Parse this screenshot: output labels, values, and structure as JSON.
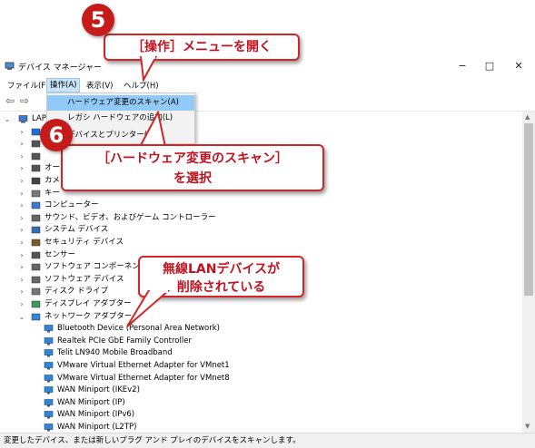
{
  "window": {
    "title": "デバイス マネージャー",
    "minimize": "−",
    "maximize": "□",
    "close": "✕"
  },
  "menu": {
    "items": [
      "ファイル(F)",
      "操作(A)",
      "表示(V)",
      "ヘルプ(H)"
    ]
  },
  "dropdown": {
    "items": [
      "ハードウェア変更のスキャン(A)",
      "レガシ ハードウェアの追加(L)",
      "デバイスとプリンター(V)"
    ]
  },
  "tree": {
    "root": "LAP",
    "categories": [
      {
        "label": "",
        "icon": "bluetooth-icon"
      },
      {
        "label": "",
        "icon": "device-icon"
      },
      {
        "label": "",
        "icon": "device-icon"
      },
      {
        "label": "オー",
        "icon": "audio-icon"
      },
      {
        "label": "カメ",
        "icon": "camera-icon"
      },
      {
        "label": "キー",
        "icon": "keyboard-icon"
      },
      {
        "label": "コンピューター",
        "icon": "computer-icon"
      },
      {
        "label": "サウンド、ビデオ、およびゲーム コントローラー",
        "icon": "speaker-icon"
      },
      {
        "label": "システム デバイス",
        "icon": "system-icon"
      },
      {
        "label": "セキュリティ デバイス",
        "icon": "security-icon"
      },
      {
        "label": "センサー",
        "icon": "sensor-icon"
      },
      {
        "label": "ソフトウェア コンポーネント",
        "icon": "software-icon"
      },
      {
        "label": "ソフトウェア デバイス",
        "icon": "software-icon"
      },
      {
        "label": "ディスク ドライブ",
        "icon": "disk-icon"
      },
      {
        "label": "ディスプレイ アダプター",
        "icon": "display-icon"
      },
      {
        "label": "ネットワーク アダプター",
        "icon": "network-icon"
      }
    ],
    "network_children": [
      "Bluetooth Device (Personal Area Network)",
      "Realtek PCIe GbE Family Controller",
      "Telit LN940 Mobile Broadband",
      "VMware Virtual Ethernet Adapter for VMnet1",
      "VMware Virtual Ethernet Adapter for VMnet8",
      "WAN Miniport (IKEv2)",
      "WAN Miniport (IP)",
      "WAN Miniport (IPv6)",
      "WAN Miniport (L2TP)"
    ]
  },
  "status": "変更したデバイス、または新しいプラグ アンド プレイのデバイスをスキャンします。",
  "annotations": {
    "step5_number": "5",
    "step5_text": "［操作］メニューを開く",
    "step6_number": "6",
    "step6_line1": "［ハードウェア変更のスキャン］",
    "step6_line2": "を選択",
    "note_line1": "無線LANデバイスが",
    "note_line2": "削除されている"
  },
  "colors": {
    "accent_red": "#c61b1b",
    "menu_highlight": "#91c9f7"
  }
}
